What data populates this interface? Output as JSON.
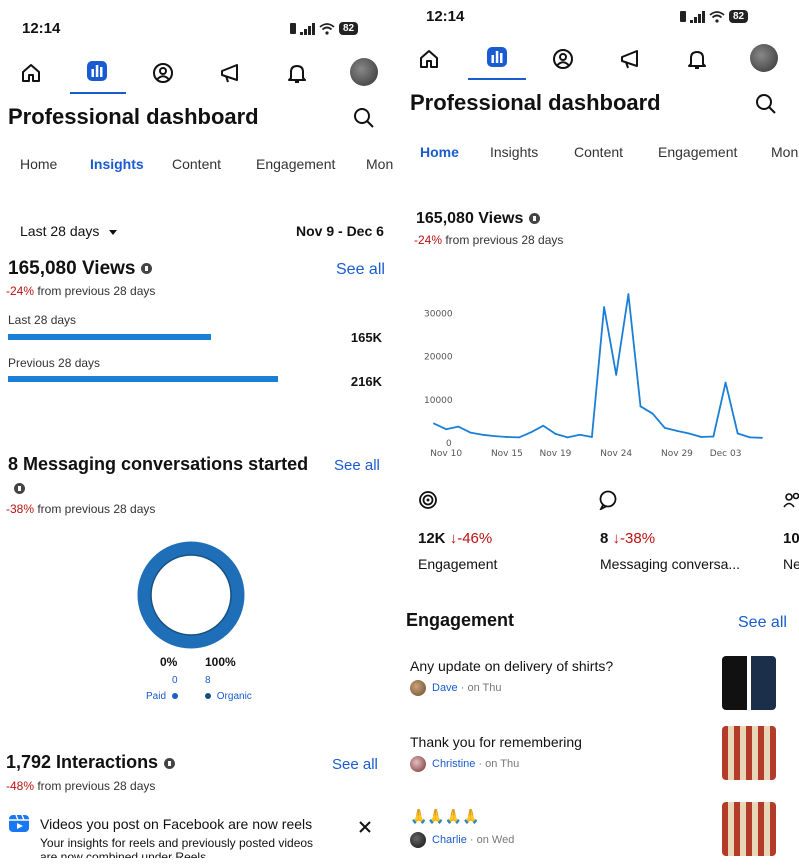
{
  "left": {
    "status": {
      "time": "12:14",
      "battery": "82"
    },
    "header": {
      "title": "Professional dashboard"
    },
    "tabs": [
      {
        "label": "Home",
        "active": false
      },
      {
        "label": "Insights",
        "active": true
      },
      {
        "label": "Content",
        "active": false
      },
      {
        "label": "Engagement",
        "active": false
      },
      {
        "label": "Mon",
        "active": false
      }
    ],
    "filter": {
      "period_label": "Last 28 days",
      "date_range": "Nov 9 - Dec 6"
    },
    "views": {
      "title": "165,080 Views",
      "see_all": "See all",
      "change_pct": "-24%",
      "change_text": " from previous 28 days",
      "rows": [
        {
          "label": "Last 28 days",
          "value": "165K",
          "fraction": 0.54
        },
        {
          "label": "Previous 28 days",
          "value": "216K",
          "fraction": 0.72
        }
      ]
    },
    "messaging": {
      "title": "8 Messaging conversations started",
      "see_all": "See all",
      "change_pct": "-38%",
      "change_text": " from previous 28 days",
      "donut": {
        "paid_pct": "0%",
        "paid_count": "0",
        "paid_label": "Paid",
        "organic_pct": "100%",
        "organic_count": "8",
        "organic_label": "Organic",
        "color": "#1f6fb8"
      }
    },
    "interactions": {
      "title": "1,792 Interactions",
      "see_all": "See all",
      "change_pct": "-48%",
      "change_text": " from previous 28 days"
    },
    "banner": {
      "title": "Videos you post on Facebook are now reels",
      "body": "Your insights for reels and previously posted videos",
      "body2": "are now combined under Reels"
    }
  },
  "right": {
    "status": {
      "time": "12:14",
      "battery": "82"
    },
    "header": {
      "title": "Professional dashboard"
    },
    "tabs": [
      {
        "label": "Home",
        "active": true
      },
      {
        "label": "Insights",
        "active": false
      },
      {
        "label": "Content",
        "active": false
      },
      {
        "label": "Engagement",
        "active": false
      },
      {
        "label": "Mon",
        "active": false
      }
    ],
    "views": {
      "title": "165,080 Views",
      "change_pct": "-24%",
      "change_text": " from previous 28 days"
    },
    "chart_data": {
      "type": "line",
      "x": [
        "Nov 9",
        "Nov 10",
        "Nov 11",
        "Nov 12",
        "Nov 13",
        "Nov 14",
        "Nov 15",
        "Nov 16",
        "Nov 17",
        "Nov 18",
        "Nov 19",
        "Nov 20",
        "Nov 21",
        "Nov 22",
        "Nov 23",
        "Nov 24",
        "Nov 25",
        "Nov 26",
        "Nov 27",
        "Nov 28",
        "Nov 29",
        "Nov 30",
        "Dec 1",
        "Dec 2",
        "Dec 3",
        "Dec 4",
        "Dec 5",
        "Dec 6"
      ],
      "values": [
        4500,
        3200,
        3800,
        2400,
        1900,
        1600,
        1400,
        1300,
        2500,
        4000,
        2100,
        1300,
        1900,
        1400,
        31500,
        15800,
        34500,
        8500,
        6800,
        3500,
        2800,
        2200,
        1400,
        1500,
        14000,
        2200,
        1300,
        1200
      ],
      "ylim": [
        0,
        35000
      ],
      "y_ticks": [
        {
          "value": 0,
          "label": "0"
        },
        {
          "value": 10000,
          "label": "10000"
        },
        {
          "value": 20000,
          "label": "20000"
        },
        {
          "value": 30000,
          "label": "30000"
        }
      ],
      "x_ticks": [
        {
          "index": 1,
          "label": "Nov 10"
        },
        {
          "index": 6,
          "label": "Nov 15"
        },
        {
          "index": 10,
          "label": "Nov 19"
        },
        {
          "index": 15,
          "label": "Nov 24"
        },
        {
          "index": 20,
          "label": "Nov 29"
        },
        {
          "index": 24,
          "label": "Dec 03"
        }
      ],
      "color": "#1b7fd6",
      "grid": false
    },
    "kpis": [
      {
        "value": "12K",
        "change": "-46%",
        "label": "Engagement",
        "icon": "engagement-icon"
      },
      {
        "value": "8",
        "change": "-38%",
        "label": "Messaging conversa...",
        "icon": "message-icon"
      },
      {
        "value": "10",
        "change": "",
        "label": "Ne",
        "icon": "people-icon"
      }
    ],
    "engagement": {
      "title": "Engagement",
      "see_all": "See all",
      "items": [
        {
          "text": "Any update on delivery of shirts?",
          "author": "Dave",
          "when": " · on Thu"
        },
        {
          "text": "Thank you for remembering",
          "author": "Christine",
          "when": " · on Thu"
        },
        {
          "text": "🙏🙏🙏🙏",
          "author": "Charlie",
          "when": " · on Wed"
        }
      ]
    }
  }
}
